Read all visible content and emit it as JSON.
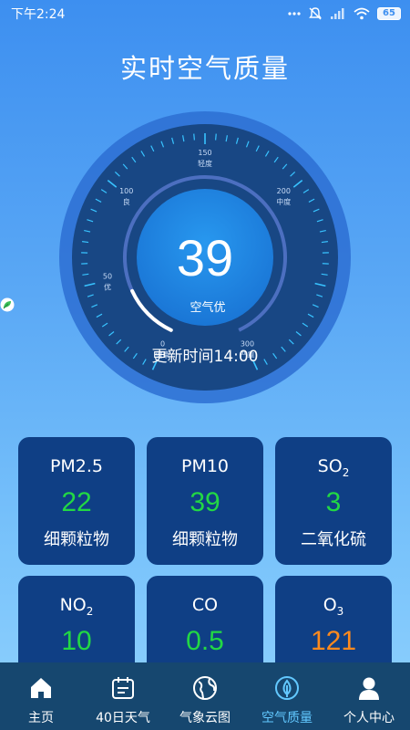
{
  "status_bar": {
    "time": "下午2:24",
    "battery": "65",
    "icons": [
      "dots-icon",
      "mute-icon",
      "signal-icon",
      "wifi-icon",
      "battery-icon"
    ]
  },
  "title": "实时空气质量",
  "gauge": {
    "aqi": "39",
    "aqi_value": 39,
    "max_value": 300,
    "level_text": "空气优",
    "update_text": "更新时间14:00",
    "scale": [
      {
        "value": "0",
        "label": "健康"
      },
      {
        "value": "50",
        "label": "优"
      },
      {
        "value": "100",
        "label": "良"
      },
      {
        "value": "150",
        "label": "轻度"
      },
      {
        "value": "200",
        "label": "中度"
      },
      {
        "value": "300",
        "label": "严重"
      }
    ],
    "colors": {
      "outer": "#2b6ccd",
      "ring": "#1a4d99",
      "inner": "#1f7fe0",
      "progress": "#ffffff",
      "track": "#4a79c9",
      "ticks": "#36c6ff"
    }
  },
  "pollutants": [
    {
      "name": "PM2.5",
      "sub": "",
      "value": "22",
      "desc": "细颗粒物",
      "color": "#22d844"
    },
    {
      "name": "PM10",
      "sub": "",
      "value": "39",
      "desc": "细颗粒物",
      "color": "#22d844"
    },
    {
      "name": "SO",
      "sub": "2",
      "value": "3",
      "desc": "二氧化硫",
      "color": "#22d844"
    },
    {
      "name": "NO",
      "sub": "2",
      "value": "10",
      "desc": "",
      "color": "#22d844"
    },
    {
      "name": "CO",
      "sub": "",
      "value": "0.5",
      "desc": "",
      "color": "#22d844"
    },
    {
      "name": "O",
      "sub": "3",
      "value": "121",
      "desc": "",
      "color": "#ff8a1d"
    }
  ],
  "nav": {
    "items": [
      {
        "label": "主页",
        "icon": "home-icon"
      },
      {
        "label": "40日天气",
        "icon": "calendar-icon"
      },
      {
        "label": "气象云图",
        "icon": "globe-icon"
      },
      {
        "label": "空气质量",
        "icon": "leaf-icon"
      },
      {
        "label": "个人中心",
        "icon": "user-icon"
      }
    ],
    "active_index": 3,
    "active_color": "#62c8ff"
  }
}
